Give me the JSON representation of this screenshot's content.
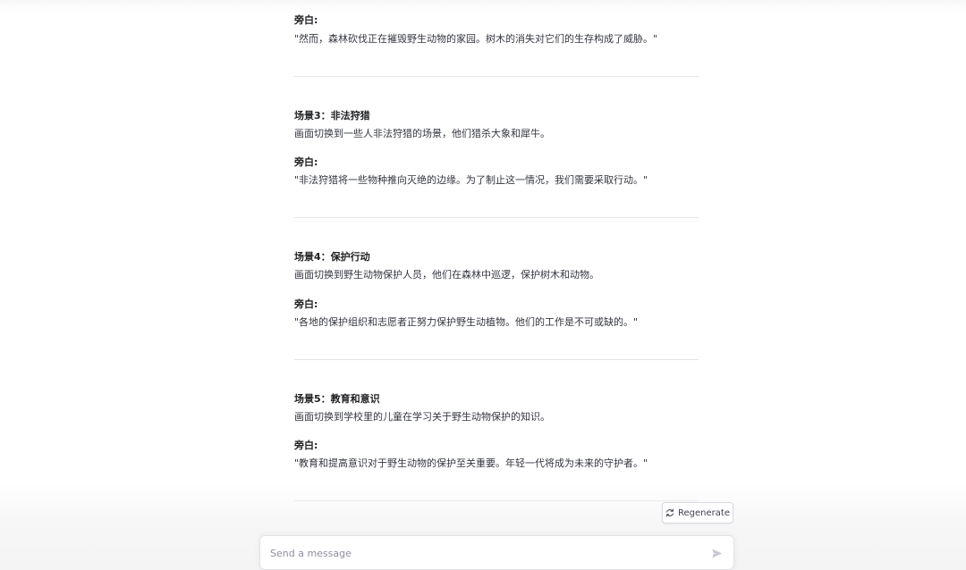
{
  "conversation": {
    "blocks": [
      {
        "narration_label": "旁白:",
        "narration_text": "\"然而，森林砍伐正在摧毁野生动物的家园。树木的消失对它们的生存构成了威胁。\""
      },
      {
        "scene_title": "场景3：非法狩猎",
        "scene_desc": "画面切换到一些人非法狩猎的场景，他们猎杀大象和犀牛。",
        "narration_label": "旁白:",
        "narration_text": "\"非法狩猎将一些物种推向灭绝的边缘。为了制止这一情况，我们需要采取行动。\""
      },
      {
        "scene_title": "场景4：保护行动",
        "scene_desc": "画面切换到野生动物保护人员，他们在森林中巡逻，保护树木和动物。",
        "narration_label": "旁白:",
        "narration_text": "\"各地的保护组织和志愿者正努力保护野生动植物。他们的工作是不可或缺的。\""
      },
      {
        "scene_title": "场景5：教育和意识",
        "scene_desc": "画面切换到学校里的儿童在学习关于野生动物保护的知识。",
        "narration_label": "旁白:",
        "narration_text": "\"教育和提高意识对于野生动物的保护至关重要。年轻一代将成为未来的守护者。\""
      }
    ]
  },
  "regenerate_label": "Regenerate",
  "composer": {
    "placeholder": "Send a message",
    "value": ""
  },
  "icons": {
    "regenerate": "refresh-icon",
    "send": "paper-plane-icon"
  },
  "colors": {
    "text": "#353740",
    "heading": "#202123",
    "divider": "#e5e5e5",
    "placeholder": "#8e8ea0"
  }
}
